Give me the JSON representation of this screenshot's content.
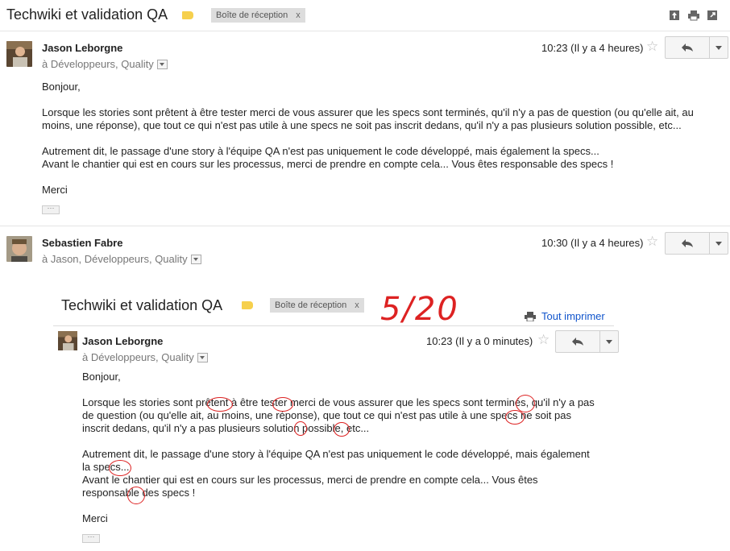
{
  "thread": {
    "subject": "Techwiki et validation QA",
    "label_chip": "Boîte de réception",
    "label_close": "x"
  },
  "messages": [
    {
      "sender": "Jason Leborgne",
      "recipients": "à Développeurs, Quality",
      "time": "10:23 (Il y a 4 heures)",
      "greeting": "Bonjour,",
      "para1_l1": "Lorsque les stories sont prêtent à être tester merci de vous assurer que les specs sont terminés, qu'il n'y a pas de question (ou qu'elle ait, au",
      "para1_l2": "moins, une réponse), que tout ce qui n'est pas utile à une specs ne soit pas inscrit dedans, qu'il n'y a pas plusieurs solution possible, etc...",
      "para2_l1": "Autrement dit, le passage d'une story à l'équipe QA n'est pas uniquement le code développé, mais également la specs...",
      "para2_l2": "Avant le chantier qui est en cours sur les processus, merci de prendre en compte cela... Vous êtes responsable des specs !",
      "closing": "Merci",
      "ellipsis": "···"
    },
    {
      "sender": "Sebastien Fabre",
      "recipients": "à Jason, Développeurs, Quality",
      "time": "10:30 (Il y a 4 heures)"
    }
  ],
  "quoted": {
    "subject": "Techwiki et validation QA",
    "label_chip": "Boîte de réception",
    "label_close": "x",
    "grade": "5/20",
    "print_all": "Tout imprimer",
    "sender": "Jason Leborgne",
    "recipients": "à Développeurs, Quality",
    "time": "10:23 (Il y a 0 minutes)",
    "greeting": "Bonjour,",
    "para1_l1": "Lorsque les stories sont prêtent à être tester merci de vous assurer que les specs sont terminés, qu'il n'y a pas",
    "para1_l2": "de question (ou qu'elle ait, au moins, une réponse), que tout ce qui n'est pas utile à une specs ne soit pas",
    "para1_l3": "inscrit dedans, qu'il n'y a pas plusieurs solution possible, etc...",
    "para2_l1": "Autrement dit, le passage d'une story à l'équipe QA n'est pas uniquement le code développé, mais également",
    "para2_l2": "la specs...",
    "para2_l3": "Avant le chantier qui est en cours sur les processus, merci de prendre en compte cela... Vous êtes",
    "para2_l4": "responsable des specs !",
    "closing": "Merci",
    "ellipsis": "···"
  },
  "colors": {
    "label_yellow": "#f6d04d",
    "link_blue": "#1155cc",
    "annotation_red": "#dd2222"
  },
  "icons": [
    "archive-icon",
    "print-icon",
    "new-window-icon",
    "reply-icon",
    "chevron-down-icon",
    "star-icon",
    "label-icon"
  ]
}
